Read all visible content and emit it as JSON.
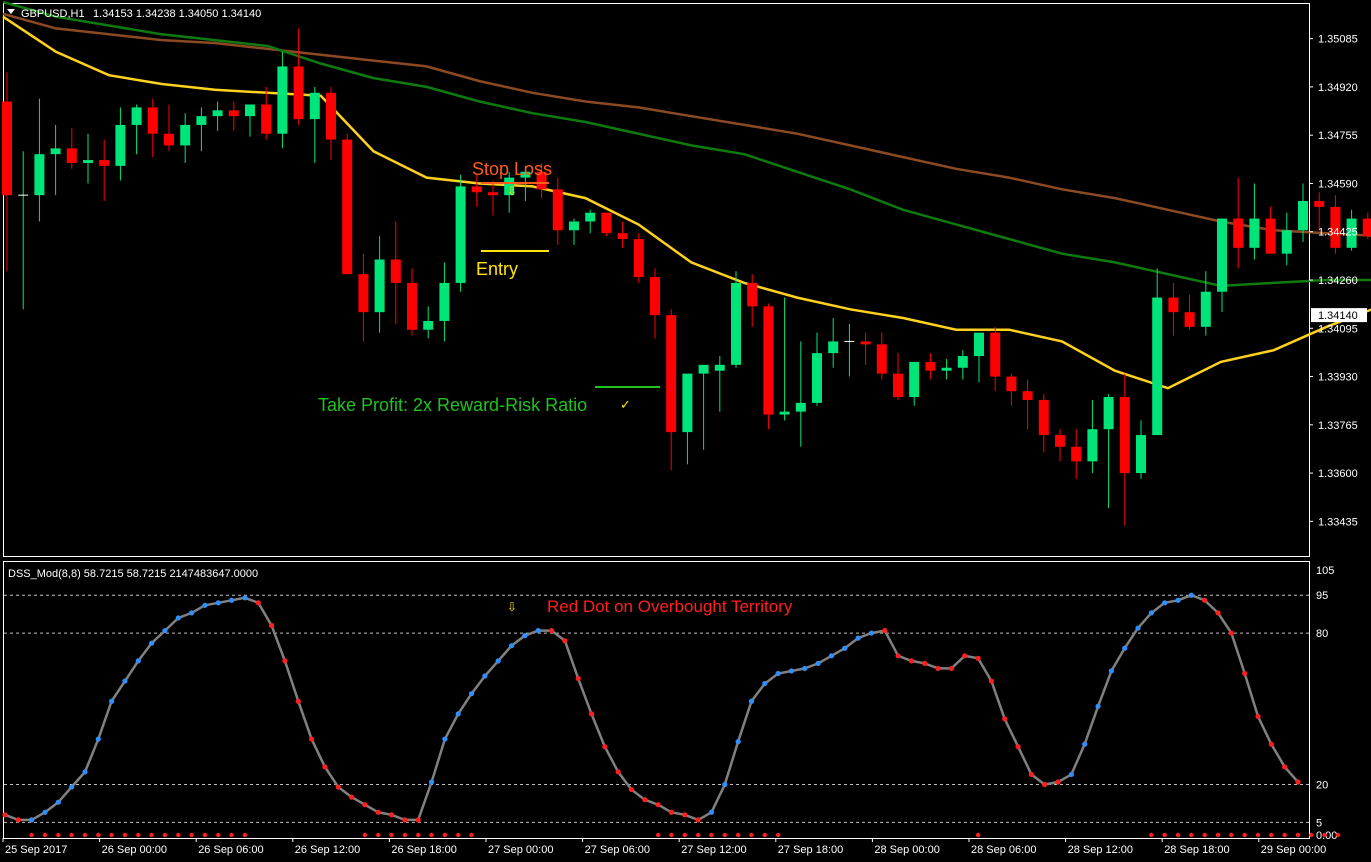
{
  "header": {
    "symbol": "GBPUSD,H1",
    "ohlc": "1.34153 1.34238 1.34050 1.34140"
  },
  "indicator": {
    "label": "DSS_Mod(8,8) 58.7215 58.7215 2147483647.0000"
  },
  "annotations": {
    "stop_loss": "Stop Loss",
    "entry": "Entry",
    "take_profit": "Take Profit: 2x Reward-Risk Ratio",
    "red_dot": "Red Dot on Overbought Territory",
    "arrow_glyph": "⇩",
    "check_glyph": "✓"
  },
  "colors": {
    "background": "#000000",
    "bull": "#00e57a",
    "bear": "#ff0000",
    "ema_yellow": "#ffd21f",
    "ema_green": "#0f7a0f",
    "ema_brown": "#8b4a22",
    "stop_loss": "#ff5a1f",
    "entry": "#ffe600",
    "take_profit": "#1fc21f",
    "dss_line": "#808080",
    "dot_blue": "#2f8fff",
    "dot_red": "#ff1f1f",
    "red_dot_text": "#ff1f1f",
    "frame": "#ffffff"
  },
  "chart_data": [
    {
      "type": "candlestick",
      "title": "GBPUSD,H1",
      "ylim": [
        1.3332,
        1.352
      ],
      "y_ticks": [
        "1.35085",
        "1.34920",
        "1.34755",
        "1.34590",
        "1.34425",
        "1.34260",
        "1.34095",
        "1.33930",
        "1.33765",
        "1.33600",
        "1.33435"
      ],
      "current_price": "1.34140",
      "x_tick_labels": [
        "25 Sep 2017",
        "26 Sep 00:00",
        "26 Sep 06:00",
        "26 Sep 12:00",
        "26 Sep 18:00",
        "27 Sep 00:00",
        "27 Sep 06:00",
        "27 Sep 12:00",
        "27 Sep 18:00",
        "28 Sep 00:00",
        "28 Sep 06:00",
        "28 Sep 12:00",
        "28 Sep 18:00",
        "29 Sep 00:00"
      ],
      "candles": [
        [
          1.3487,
          1.3497,
          1.3429,
          1.3455
        ],
        [
          1.3455,
          1.347,
          1.3416,
          1.3455
        ],
        [
          1.3455,
          1.3488,
          1.3446,
          1.3469
        ],
        [
          1.3469,
          1.3479,
          1.3455,
          1.3471
        ],
        [
          1.3471,
          1.3478,
          1.3464,
          1.3466
        ],
        [
          1.3466,
          1.3476,
          1.3459,
          1.3467
        ],
        [
          1.3467,
          1.3474,
          1.3453,
          1.3465
        ],
        [
          1.3465,
          1.3485,
          1.346,
          1.3479
        ],
        [
          1.3479,
          1.3486,
          1.3469,
          1.3485
        ],
        [
          1.3485,
          1.3488,
          1.3468,
          1.3476
        ],
        [
          1.3476,
          1.3486,
          1.347,
          1.3472
        ],
        [
          1.3472,
          1.3483,
          1.3466,
          1.3479
        ],
        [
          1.3479,
          1.3485,
          1.347,
          1.3482
        ],
        [
          1.3482,
          1.3487,
          1.3477,
          1.3484
        ],
        [
          1.3484,
          1.3487,
          1.3477,
          1.3482
        ],
        [
          1.3482,
          1.3486,
          1.3475,
          1.3486
        ],
        [
          1.3486,
          1.3492,
          1.3474,
          1.3476
        ],
        [
          1.3476,
          1.3504,
          1.3471,
          1.3499
        ],
        [
          1.3499,
          1.3512,
          1.3479,
          1.3481
        ],
        [
          1.3481,
          1.3492,
          1.3466,
          1.349
        ],
        [
          1.349,
          1.3492,
          1.3467,
          1.3474
        ],
        [
          1.3474,
          1.3476,
          1.3428,
          1.3428
        ],
        [
          1.3428,
          1.3435,
          1.3405,
          1.3415
        ],
        [
          1.3415,
          1.3441,
          1.3408,
          1.3433
        ],
        [
          1.3433,
          1.3446,
          1.3411,
          1.3425
        ],
        [
          1.3425,
          1.343,
          1.3407,
          1.3409
        ],
        [
          1.3409,
          1.3417,
          1.3406,
          1.3412
        ],
        [
          1.3412,
          1.3432,
          1.3405,
          1.3425
        ],
        [
          1.3425,
          1.3462,
          1.3422,
          1.3458
        ],
        [
          1.3458,
          1.3462,
          1.3451,
          1.3456
        ],
        [
          1.3456,
          1.346,
          1.3448,
          1.3455
        ],
        [
          1.3455,
          1.3463,
          1.3449,
          1.3461
        ],
        [
          1.3461,
          1.3465,
          1.3453,
          1.3463
        ],
        [
          1.3463,
          1.3466,
          1.3454,
          1.3457
        ],
        [
          1.3457,
          1.3461,
          1.3438,
          1.3443
        ],
        [
          1.3443,
          1.3447,
          1.3438,
          1.3446
        ],
        [
          1.3446,
          1.345,
          1.3442,
          1.3449
        ],
        [
          1.3449,
          1.3449,
          1.3441,
          1.3442
        ],
        [
          1.3442,
          1.3446,
          1.3437,
          1.344
        ],
        [
          1.344,
          1.3442,
          1.3425,
          1.3427
        ],
        [
          1.3427,
          1.343,
          1.3406,
          1.3414
        ],
        [
          1.3414,
          1.3416,
          1.3361,
          1.3374
        ],
        [
          1.3374,
          1.3393,
          1.3363,
          1.3394
        ],
        [
          1.3394,
          1.3396,
          1.3368,
          1.3397
        ],
        [
          1.3395,
          1.34,
          1.3381,
          1.3397
        ],
        [
          1.3397,
          1.3429,
          1.3396,
          1.3425
        ],
        [
          1.3425,
          1.3428,
          1.341,
          1.3417
        ],
        [
          1.3417,
          1.3418,
          1.3375,
          1.338
        ],
        [
          1.338,
          1.342,
          1.3378,
          1.3381
        ],
        [
          1.3381,
          1.3405,
          1.3369,
          1.3384
        ],
        [
          1.3384,
          1.3408,
          1.3383,
          1.3401
        ],
        [
          1.3401,
          1.3413,
          1.3396,
          1.3405
        ],
        [
          1.3405,
          1.3411,
          1.3393,
          1.3405
        ],
        [
          1.3405,
          1.3408,
          1.3397,
          1.3404
        ],
        [
          1.3404,
          1.3408,
          1.3392,
          1.3394
        ],
        [
          1.3394,
          1.3401,
          1.3385,
          1.3386
        ],
        [
          1.3386,
          1.3396,
          1.3383,
          1.3398
        ],
        [
          1.3398,
          1.3401,
          1.3392,
          1.3395
        ],
        [
          1.3395,
          1.3399,
          1.3392,
          1.3396
        ],
        [
          1.3396,
          1.3402,
          1.3392,
          1.34
        ],
        [
          1.34,
          1.3406,
          1.3391,
          1.3408
        ],
        [
          1.3408,
          1.341,
          1.3388,
          1.3393
        ],
        [
          1.3393,
          1.3394,
          1.3383,
          1.3388
        ],
        [
          1.3388,
          1.3392,
          1.3375,
          1.3385
        ],
        [
          1.3385,
          1.3387,
          1.3367,
          1.3373
        ],
        [
          1.3373,
          1.3375,
          1.3364,
          1.3369
        ],
        [
          1.3369,
          1.3375,
          1.3358,
          1.3364
        ],
        [
          1.3364,
          1.3385,
          1.336,
          1.3375
        ],
        [
          1.3375,
          1.3387,
          1.3348,
          1.3386
        ],
        [
          1.3386,
          1.3394,
          1.3342,
          1.336
        ],
        [
          1.336,
          1.3378,
          1.3358,
          1.3373
        ],
        [
          1.3373,
          1.343,
          1.3373,
          1.342
        ],
        [
          1.342,
          1.3425,
          1.3407,
          1.3415
        ],
        [
          1.3415,
          1.3421,
          1.3409,
          1.341
        ],
        [
          1.341,
          1.3429,
          1.3407,
          1.3422
        ],
        [
          1.3422,
          1.344,
          1.3415,
          1.3447
        ],
        [
          1.3447,
          1.3461,
          1.343,
          1.3437
        ],
        [
          1.3437,
          1.3459,
          1.3433,
          1.3447
        ],
        [
          1.3447,
          1.3451,
          1.3435,
          1.3435
        ],
        [
          1.3435,
          1.3449,
          1.3431,
          1.3443
        ],
        [
          1.3443,
          1.3459,
          1.3439,
          1.3453
        ],
        [
          1.3453,
          1.3456,
          1.3443,
          1.3451
        ],
        [
          1.3451,
          1.3455,
          1.3435,
          1.3437
        ],
        [
          1.3437,
          1.345,
          1.3436,
          1.3447
        ],
        [
          1.3447,
          1.3449,
          1.344,
          1.3441
        ],
        [
          1.3441,
          1.3446,
          1.3434,
          1.3442
        ],
        [
          1.3442,
          1.3445,
          1.3432,
          1.3437
        ],
        [
          1.3437,
          1.344,
          1.3429,
          1.343
        ],
        [
          1.343,
          1.3432,
          1.3421,
          1.3426
        ]
      ],
      "series": [
        {
          "color": "ema_brown",
          "values": [
            1.3517,
            1.3512,
            1.351,
            1.3508,
            1.3507,
            1.3505,
            1.3503,
            1.3501,
            1.3499,
            1.3494,
            1.349,
            1.3487,
            1.3485,
            1.3482,
            1.3479,
            1.3476,
            1.3472,
            1.3468,
            1.3464,
            1.3461,
            1.3457,
            1.3454,
            1.345,
            1.3446,
            1.3443,
            1.3442,
            1.3441,
            1.344
          ]
        },
        {
          "color": "ema_green",
          "values": [
            1.3521,
            1.3516,
            1.3513,
            1.351,
            1.3508,
            1.3506,
            1.35,
            1.3495,
            1.3492,
            1.3487,
            1.3483,
            1.348,
            1.3476,
            1.3472,
            1.3469,
            1.3463,
            1.3457,
            1.345,
            1.3445,
            1.344,
            1.3435,
            1.3432,
            1.3428,
            1.3424,
            1.3425,
            1.3426,
            1.3426,
            1.3426
          ]
        },
        {
          "color": "ema_yellow",
          "values": [
            1.3516,
            1.3504,
            1.3496,
            1.3493,
            1.3491,
            1.349,
            1.3489,
            1.347,
            1.3461,
            1.3459,
            1.3458,
            1.3454,
            1.3445,
            1.3432,
            1.3425,
            1.342,
            1.3416,
            1.3413,
            1.3409,
            1.3409,
            1.3405,
            1.3395,
            1.3389,
            1.3398,
            1.3402,
            1.341,
            1.3417,
            1.3419
          ]
        }
      ]
    },
    {
      "type": "line",
      "title": "DSS_Mod(8,8)",
      "ylim": [
        0,
        105
      ],
      "y_ticks": [
        "105",
        "95",
        "80",
        "20",
        "5",
        "0.00"
      ],
      "levels": [
        95,
        80,
        20,
        5
      ],
      "values": [
        8,
        6,
        6,
        9,
        13,
        19,
        25,
        38,
        53,
        61,
        69,
        76,
        81,
        86,
        88,
        91,
        92,
        93,
        94,
        92,
        83,
        69,
        53,
        38,
        27,
        19,
        15,
        12,
        9,
        8,
        6,
        6,
        21,
        38,
        48,
        56,
        63,
        69,
        75,
        79,
        81,
        81,
        77,
        62,
        48,
        35,
        25,
        18,
        14,
        12,
        9,
        8,
        6,
        9,
        20,
        37,
        53,
        60,
        64,
        65,
        66,
        68,
        71,
        74,
        78,
        80,
        81,
        71,
        69,
        68,
        66,
        66,
        71,
        70,
        61,
        46,
        35,
        24,
        20,
        21,
        24,
        36,
        51,
        65,
        74,
        82,
        88,
        92,
        93,
        95,
        93,
        88,
        80,
        64,
        47,
        36,
        27,
        21
      ],
      "dot_colors": [
        "r",
        "r",
        "b",
        "b",
        "b",
        "b",
        "b",
        "b",
        "b",
        "b",
        "b",
        "b",
        "b",
        "b",
        "b",
        "b",
        "b",
        "b",
        "b",
        "r",
        "r",
        "r",
        "r",
        "r",
        "r",
        "r",
        "r",
        "r",
        "r",
        "r",
        "r",
        "r",
        "b",
        "b",
        "b",
        "b",
        "b",
        "b",
        "b",
        "b",
        "b",
        "r",
        "r",
        "r",
        "r",
        "r",
        "r",
        "r",
        "r",
        "r",
        "r",
        "r",
        "r",
        "b",
        "b",
        "b",
        "b",
        "b",
        "b",
        "b",
        "b",
        "b",
        "b",
        "b",
        "b",
        "b",
        "r",
        "r",
        "r",
        "r",
        "r",
        "r",
        "r",
        "r",
        "r",
        "r",
        "r",
        "r",
        "r",
        "r",
        "b",
        "b",
        "b",
        "b",
        "b",
        "b",
        "b",
        "b",
        "b",
        "b",
        "r",
        "r",
        "r",
        "r",
        "r",
        "r",
        "r",
        "r"
      ],
      "bottom_marker_indices": [
        2,
        3,
        4,
        5,
        6,
        7,
        8,
        9,
        10,
        11,
        12,
        13,
        14,
        15,
        16,
        17,
        18,
        27,
        28,
        29,
        30,
        31,
        32,
        33,
        34,
        35,
        49,
        50,
        51,
        52,
        53,
        54,
        55,
        56,
        57,
        58,
        73,
        86,
        87,
        88,
        89,
        90,
        91,
        92,
        93,
        94,
        95,
        96,
        97,
        98,
        99,
        100
      ]
    }
  ]
}
